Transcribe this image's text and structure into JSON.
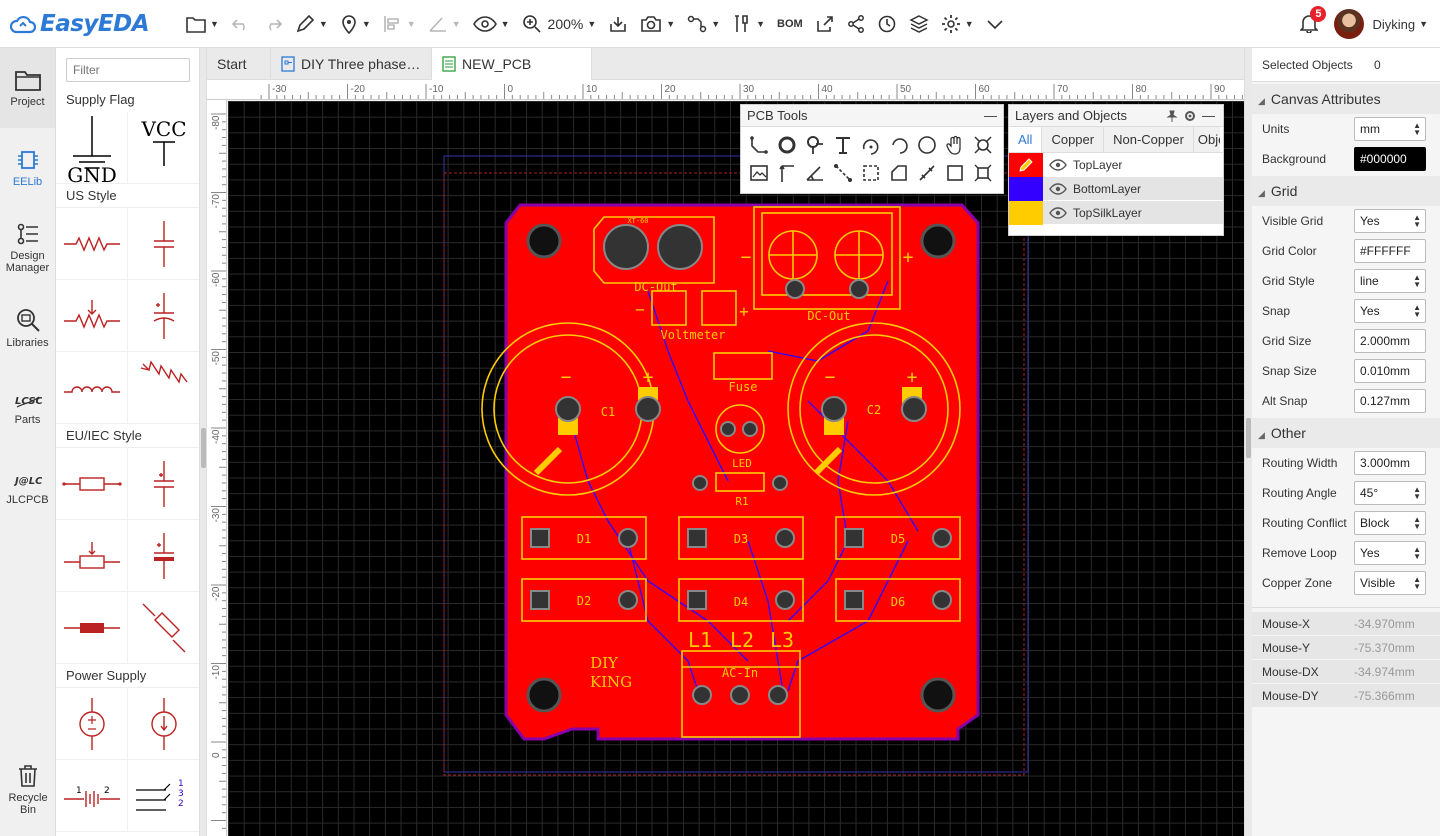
{
  "app": {
    "logo_text": "EasyEDA"
  },
  "toolbar": {
    "zoom": "200%",
    "bom_label": "BOM"
  },
  "user": {
    "name": "Diyking",
    "notifications": "5"
  },
  "leftnav": [
    {
      "label": "Project"
    },
    {
      "label": "EELib"
    },
    {
      "label": "Design Manager"
    },
    {
      "label": "Libraries"
    },
    {
      "label": "Parts"
    },
    {
      "label": "JLCPCB"
    },
    {
      "label": "Recycle Bin"
    }
  ],
  "library": {
    "filter_placeholder": "Filter",
    "sections": {
      "supply_flag": "Supply Flag",
      "us_style": "US Style",
      "eu_style": "EU/IEC Style",
      "power_supply": "Power Supply"
    },
    "gnd_label": "GND",
    "vcc_label": "VCC"
  },
  "tabs": [
    {
      "label": "Start"
    },
    {
      "label": "DIY Three phase…"
    },
    {
      "label": "NEW_PCB"
    }
  ],
  "ruler": {
    "x_ticks": [
      "-30",
      "-20",
      "-10",
      "0",
      "10",
      "20",
      "30",
      "40",
      "50",
      "60",
      "70",
      "80",
      "90"
    ],
    "y_ticks": [
      "-80",
      "-70",
      "-60",
      "-50",
      "-40",
      "-30",
      "-20",
      "-10",
      "0"
    ]
  },
  "pcb_tools": {
    "title": "PCB Tools"
  },
  "layers_panel": {
    "title": "Layers and Objects",
    "tabs": [
      "All",
      "Copper",
      "Non-Copper",
      "Obje"
    ],
    "layers": [
      {
        "name": "TopLayer",
        "color": "#FF0000"
      },
      {
        "name": "BottomLayer",
        "color": "#3300FF"
      },
      {
        "name": "TopSilkLayer",
        "color": "#FFCC00"
      }
    ]
  },
  "board": {
    "labels": {
      "xt60": "XT-60",
      "dc_out_left": "DC-Out",
      "dc_out_right": "DC-Out",
      "voltmeter": "Voltmeter",
      "fuse": "Fuse",
      "c1": "C1",
      "c2": "C2",
      "led": "LED",
      "r1": "R1",
      "d1": "D1",
      "d2": "D2",
      "d3": "D3",
      "d4": "D4",
      "d5": "D5",
      "d6": "D6",
      "l1": "L1",
      "l2": "L2",
      "l3": "L3",
      "ac_in": "AC-In",
      "diy": "DIY",
      "king": "KING",
      "plus": "+",
      "minus": "−"
    },
    "colors": {
      "copper": "#FF0000",
      "silk": "#FFCC00",
      "bottom": "#3300FF",
      "outline": "#8800AA"
    }
  },
  "properties": {
    "selected_label": "Selected Objects",
    "selected_count": "0",
    "canvas_header": "Canvas Attributes",
    "units_label": "Units",
    "units": "mm",
    "background_label": "Background",
    "background": "#000000",
    "grid_header": "Grid",
    "visible_grid_label": "Visible Grid",
    "visible_grid": "Yes",
    "grid_color_label": "Grid Color",
    "grid_color": "#FFFFFF",
    "grid_style_label": "Grid Style",
    "grid_style": "line",
    "snap_label": "Snap",
    "snap": "Yes",
    "grid_size_label": "Grid Size",
    "grid_size": "2.000mm",
    "snap_size_label": "Snap Size",
    "snap_size": "0.010mm",
    "alt_snap_label": "Alt Snap",
    "alt_snap": "0.127mm",
    "other_header": "Other",
    "routing_width_label": "Routing Width",
    "routing_width": "3.000mm",
    "routing_angle_label": "Routing Angle",
    "routing_angle": "45°",
    "routing_conflict_label": "Routing Conflict",
    "routing_conflict": "Block",
    "remove_loop_label": "Remove Loop",
    "remove_loop": "Yes",
    "copper_zone_label": "Copper Zone",
    "copper_zone": "Visible"
  },
  "mouse": {
    "x_label": "Mouse-X",
    "x": "-34.970mm",
    "y_label": "Mouse-Y",
    "y": "-75.370mm",
    "dx_label": "Mouse-DX",
    "dx": "-34.974mm",
    "dy_label": "Mouse-DY",
    "dy": "-75.366mm"
  }
}
